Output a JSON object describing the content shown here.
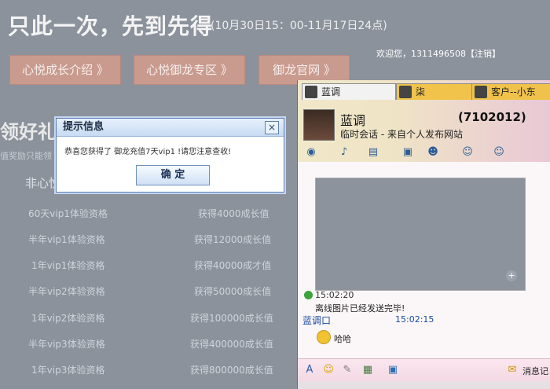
{
  "page": {
    "headline": "只此一次，先到先得",
    "headline_sub": "(10月30日15：00-11月17日24点)",
    "welcome": "欢迎您，1311496508【注销】",
    "tabs": [
      "心悦成长介绍 》",
      "心悦御龙专区 》",
      "御龙官网 》"
    ],
    "big_left": "领好礼",
    "small_left": "值奖励只能领",
    "col_head_left": "非心悦",
    "rows": [
      {
        "left": "60天vip1体验资格",
        "right": "获得4000成长值"
      },
      {
        "left": "半年vip1体验资格",
        "right": "获得12000成长值"
      },
      {
        "left": "1年vip1体验资格",
        "right": "获得40000成才值"
      },
      {
        "left": "半年vip2体验资格",
        "right": "获得50000成长值"
      },
      {
        "left": "1年vip2体验资格",
        "right": "获得100000成长值"
      },
      {
        "left": "半年vip3体验资格",
        "right": "获得400000成长值"
      },
      {
        "left": "1年vip3体验资格",
        "right": "获得800000成长值"
      }
    ]
  },
  "dialog": {
    "title": "提示信息",
    "close": "×",
    "message": "恭喜您获得了 御龙充值7天vip1 !请您注意查收!",
    "ok": "确  定"
  },
  "chat": {
    "tabs": [
      "蓝调",
      "柒",
      "客户--小东"
    ],
    "contact_name": "蓝调",
    "contact_id": "(7102012)",
    "status": "临时会话 - 来自个人发布网站",
    "messages": {
      "time1": "15:02:20",
      "system": "离线图片已经发送完毕!",
      "sender": "蓝调口",
      "sender_time": "15:02:15",
      "text": "哈哈"
    },
    "footer": {
      "history": "消息记"
    }
  },
  "colors": {
    "accent": "#5b7fb8",
    "tab_button": "#c99a8e",
    "chat_blue": "#1a4aa0"
  },
  "icons": [
    "search-icon",
    "microphone-icon",
    "folder-icon",
    "screen-icon",
    "user-icon",
    "group-icon",
    "zoom-icon",
    "emoji-icon",
    "picture-icon",
    "font-icon",
    "check-icon"
  ]
}
